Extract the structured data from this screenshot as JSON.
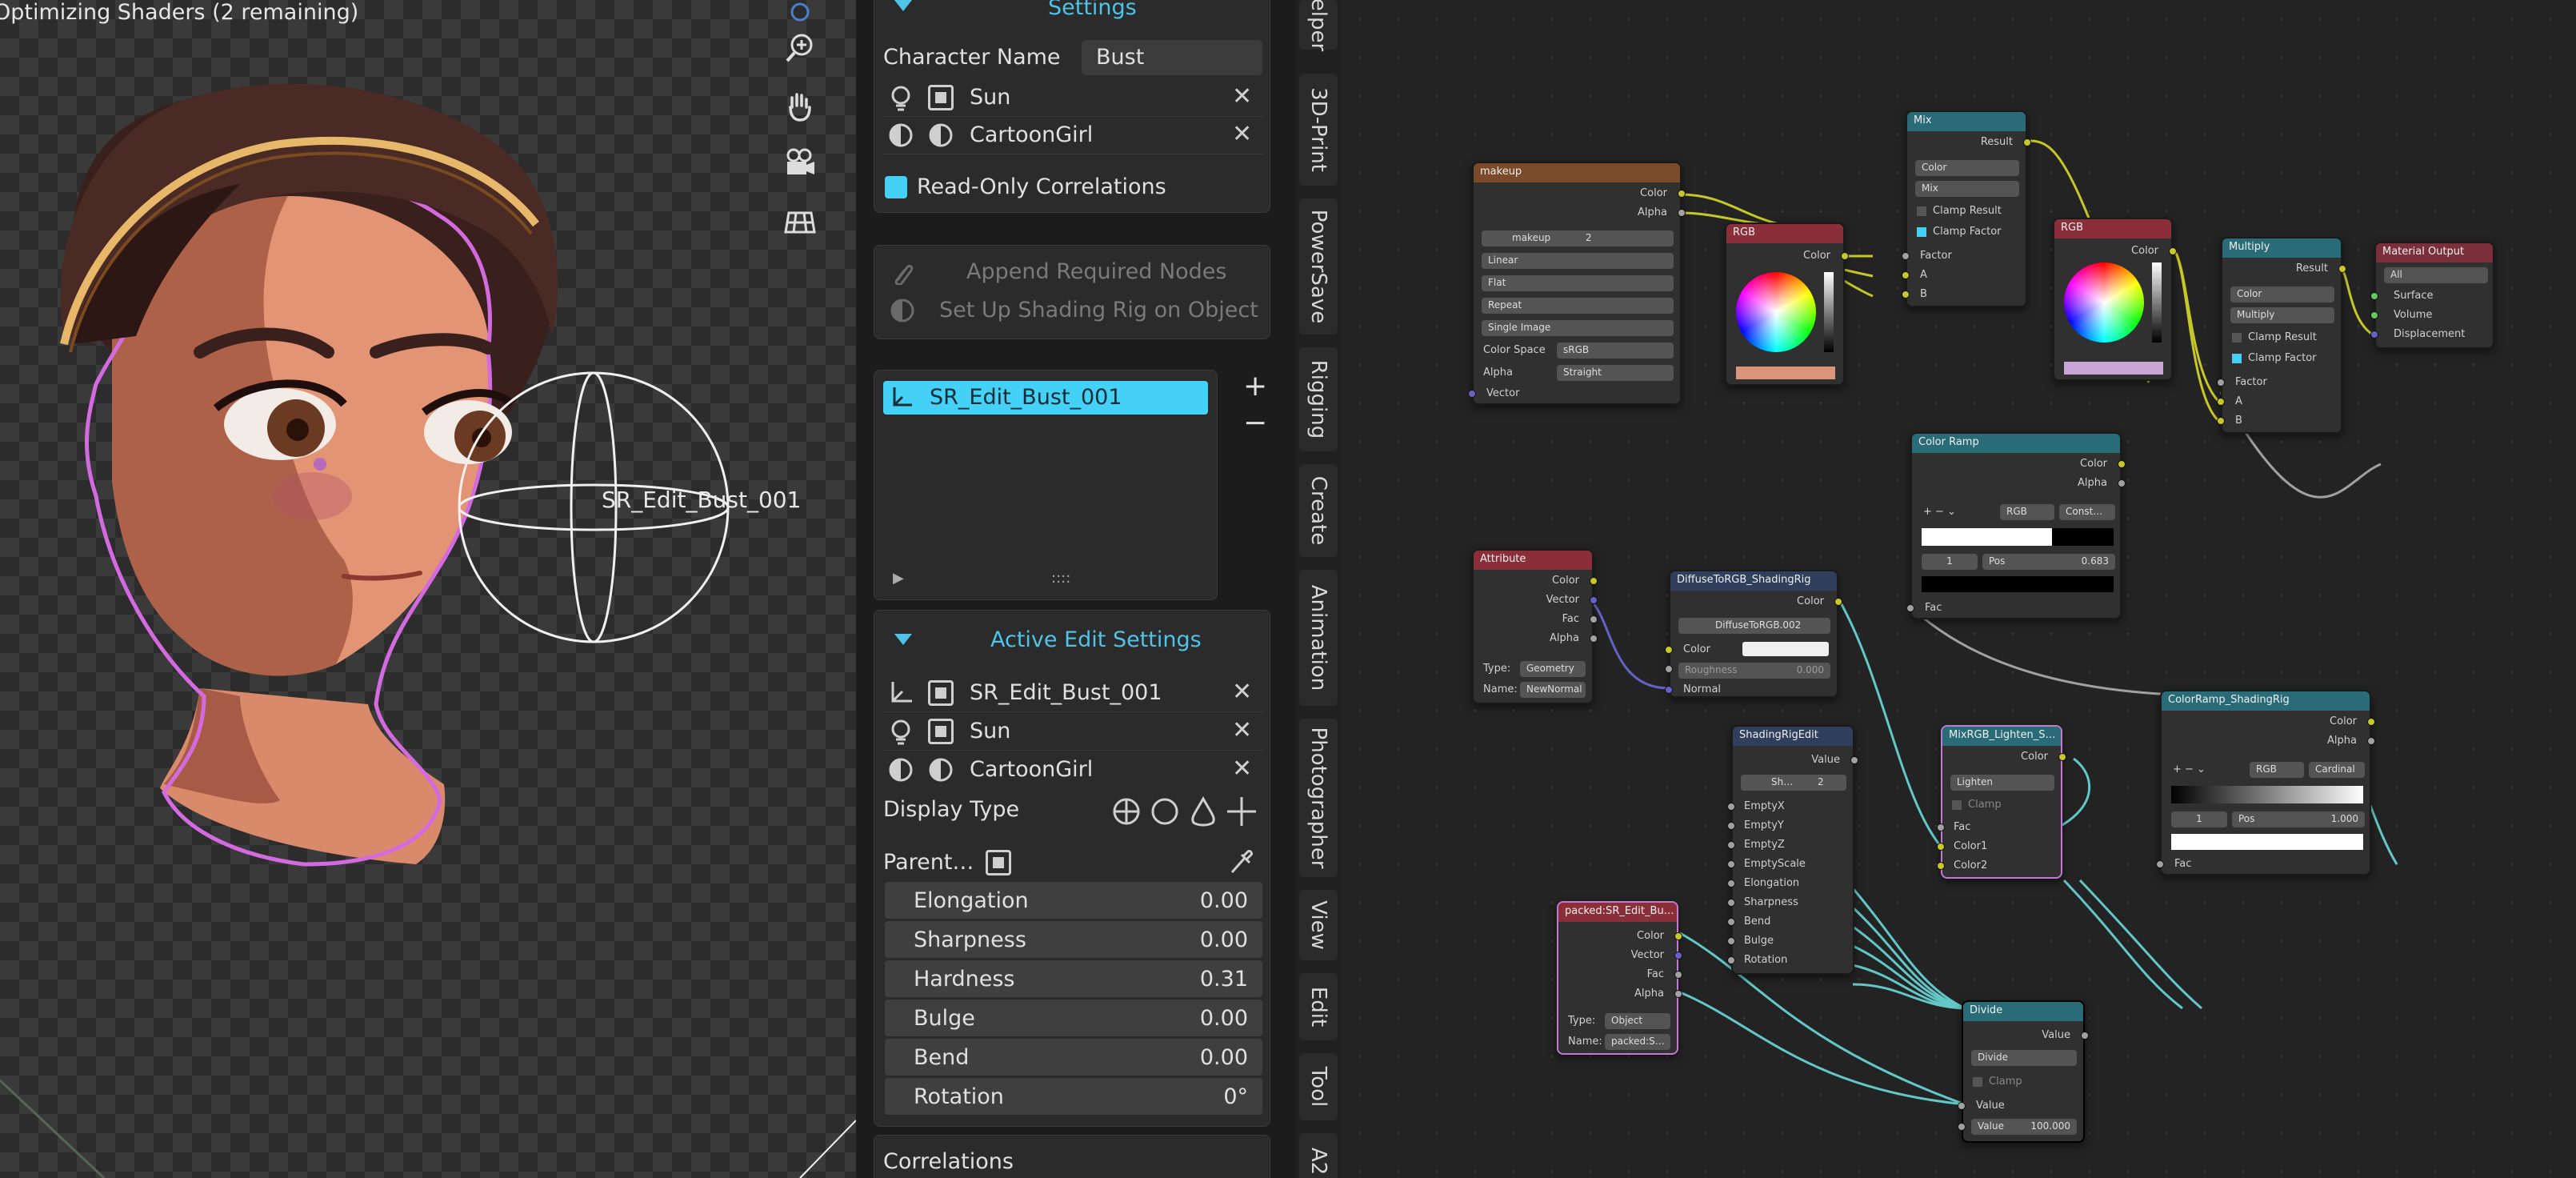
{
  "viewport": {
    "status_text": "Optimizing Shaders (2 remaining)",
    "object_label": "SR_Edit_Bust_001",
    "nav_icons": [
      "zoom-icon",
      "hand-pan-icon",
      "camera-icon",
      "grid-view-icon"
    ]
  },
  "settings_panel": {
    "header": "Settings",
    "character_name_label": "Character Name",
    "character_name_value": "Bust",
    "rows": [
      {
        "icon": "light-icon",
        "name": "Sun"
      },
      {
        "icon": "material-icon",
        "name": "CartoonGirl"
      }
    ],
    "readonly_label": "Read-Only Correlations",
    "readonly_checked": true
  },
  "actions": {
    "append_nodes": "Append Required Nodes",
    "setup_rig": "Set Up Shading Rig on Object"
  },
  "list": {
    "items": [
      "SR_Edit_Bust_001"
    ],
    "add": "+",
    "remove": "−"
  },
  "active_edit": {
    "header": "Active Edit Settings",
    "rows": [
      {
        "icon": "empty-icon",
        "name": "SR_Edit_Bust_001"
      },
      {
        "icon": "light-icon",
        "name": "Sun"
      },
      {
        "icon": "material-icon",
        "name": "CartoonGirl"
      }
    ],
    "display_type_label": "Display Type",
    "parent_label": "Parent…",
    "properties": [
      {
        "label": "Elongation",
        "value": "0.00"
      },
      {
        "label": "Sharpness",
        "value": "0.00"
      },
      {
        "label": "Hardness",
        "value": "0.31"
      },
      {
        "label": "Bulge",
        "value": "0.00"
      },
      {
        "label": "Bend",
        "value": "0.00"
      },
      {
        "label": "Rotation",
        "value": "0°"
      }
    ]
  },
  "correlations_label": "Correlations",
  "vertical_tabs": [
    "elper",
    "3D-Print",
    "PowerSave",
    "Rigging",
    "Create",
    "Animation",
    "Photographer",
    "View",
    "Edit",
    "Tool",
    "A2"
  ],
  "nodes": {
    "makeup": {
      "title": "makeup",
      "out1": "Color",
      "out2": "Alpha",
      "image": "makeup",
      "users": "2",
      "interp": "Linear",
      "proj": "Flat",
      "ext": "Repeat",
      "source": "Single Image",
      "cs_label": "Color Space",
      "cs_value": "sRGB",
      "alpha_label": "Alpha",
      "alpha_value": "Straight",
      "vector": "Vector"
    },
    "rgb1": {
      "title": "RGB",
      "out": "Color",
      "color": "#d9967a"
    },
    "mix": {
      "title": "Mix",
      "out": "Result",
      "type": "Color",
      "mode": "Mix",
      "clamp_result": "Clamp Result",
      "clamp_factor": "Clamp Factor",
      "factor": "Factor",
      "a": "A",
      "b": "B"
    },
    "rgb2": {
      "title": "RGB",
      "out": "Color",
      "color": "#c9a6d6"
    },
    "multiply": {
      "title": "Multiply",
      "out": "Result",
      "type": "Color",
      "mode": "Multiply",
      "clamp_result": "Clamp Result",
      "clamp_factor": "Clamp Factor",
      "factor": "Factor",
      "a": "A",
      "b": "B"
    },
    "matout": {
      "title": "Material Output",
      "target": "All",
      "surface": "Surface",
      "volume": "Volume",
      "displacement": "Displacement"
    },
    "colorramp": {
      "title": "Color Ramp",
      "out1": "Color",
      "out2": "Alpha",
      "mode": "RGB",
      "interp": "Const…",
      "index": "1",
      "pos_label": "Pos",
      "pos_value": "0.683",
      "fac": "Fac"
    },
    "attribute": {
      "title": "Attribute",
      "out1": "Color",
      "out2": "Vector",
      "out3": "Fac",
      "out4": "Alpha",
      "type_label": "Type:",
      "type_value": "Geometry",
      "name_label": "Name:",
      "name_value": "NewNormal"
    },
    "diffuse": {
      "title": "DiffuseToRGB_ShadingRig",
      "out": "Color",
      "group": "DiffuseToRGB.002",
      "in1": "Color",
      "in2": "Roughness",
      "rough_value": "0.000",
      "in3": "Normal"
    },
    "shadingrig": {
      "title": "ShadingRigEdit",
      "out": "Value",
      "group": "Sh…",
      "users": "2",
      "inputs": [
        "EmptyX",
        "EmptyY",
        "EmptyZ",
        "EmptyScale",
        "Elongation",
        "Sharpness",
        "Bend",
        "Bulge",
        "Rotation"
      ]
    },
    "mixrgb": {
      "title": "MixRGB_Lighten_S…",
      "out": "Color",
      "mode": "Lighten",
      "clamp": "Clamp",
      "fac": "Fac",
      "c1": "Color1",
      "c2": "Color2"
    },
    "rampshading": {
      "title": "ColorRamp_ShadingRig",
      "out1": "Color",
      "out2": "Alpha",
      "mode": "RGB",
      "interp": "Cardinal",
      "index": "1",
      "pos_label": "Pos",
      "pos_value": "1.000",
      "fac": "Fac"
    },
    "packed": {
      "title": "packed:SR_Edit_Bu…",
      "out1": "Color",
      "out2": "Vector",
      "out3": "Fac",
      "out4": "Alpha",
      "type_label": "Type:",
      "type_value": "Object",
      "name_label": "Name:",
      "name_value": "packed:S…"
    },
    "divide": {
      "title": "Divide",
      "out": "Value",
      "mode": "Divide",
      "clamp": "Clamp",
      "in1": "Value",
      "in2_label": "Value",
      "in2_value": "100.000"
    }
  },
  "colors": {
    "accent": "#4fc3e8",
    "list_selected": "#45d0f5",
    "node_image": "#7a4a2b",
    "node_color": "#8a2f3a",
    "node_converter": "#2a6b78",
    "node_group": "#2f3f5c",
    "node_input": "#8a2f3a",
    "node_output": "#7a2f3a"
  }
}
